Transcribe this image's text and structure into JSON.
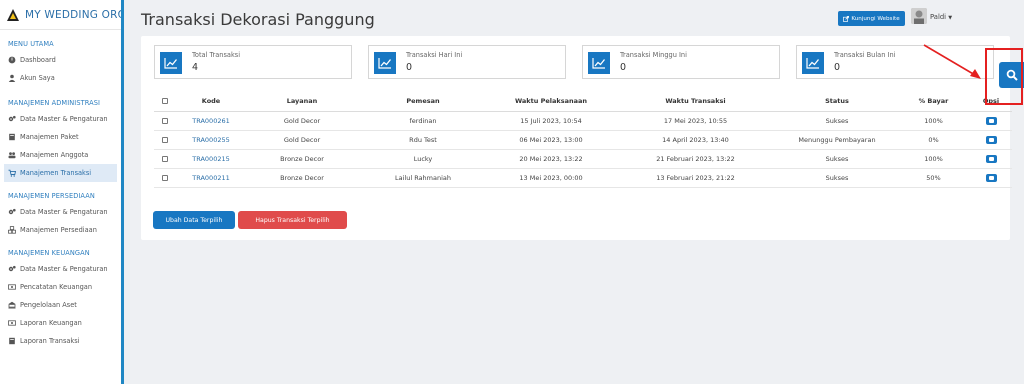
{
  "sidebar": {
    "brand": "MY WEDDING ORGAN",
    "sections": [
      {
        "title": "MENU UTAMA",
        "items": [
          {
            "label": "Dashboard",
            "icon": "dashboard-icon"
          },
          {
            "label": "Akun Saya",
            "icon": "user-icon"
          }
        ]
      },
      {
        "title": "MANAJEMEN ADMINISTRASI",
        "items": [
          {
            "label": "Data Master & Pengaturan",
            "icon": "cogs-icon"
          },
          {
            "label": "Manajemen Paket",
            "icon": "book-icon"
          },
          {
            "label": "Manajemen Anggota",
            "icon": "users-icon"
          },
          {
            "label": "Manajemen Transaksi",
            "icon": "cart-icon",
            "active": true
          }
        ]
      },
      {
        "title": "MANAJEMEN PERSEDIAAN",
        "items": [
          {
            "label": "Data Master & Pengaturan",
            "icon": "cogs-icon"
          },
          {
            "label": "Manajemen Persediaan",
            "icon": "boxes-icon"
          }
        ]
      },
      {
        "title": "MANAJEMEN KEUANGAN",
        "items": [
          {
            "label": "Data Master & Pengaturan",
            "icon": "cogs-icon"
          },
          {
            "label": "Pencatatan Keuangan",
            "icon": "money-icon"
          },
          {
            "label": "Pengelolaan Aset",
            "icon": "bank-icon"
          },
          {
            "label": "Laporan Keuangan",
            "icon": "money-icon"
          },
          {
            "label": "Laporan Transaksi",
            "icon": "book-icon"
          }
        ]
      }
    ]
  },
  "header": {
    "title": "Transaksi Dekorasi Panggung",
    "visit_button": "Kunjungi Website",
    "user_name": "Paldi"
  },
  "stats": [
    {
      "label": "Total Transaksi",
      "value": "4"
    },
    {
      "label": "Transaksi Hari Ini",
      "value": "0"
    },
    {
      "label": "Transaksi Minggu Ini",
      "value": "0"
    },
    {
      "label": "Transaksi Bulan Ini",
      "value": "0"
    }
  ],
  "table": {
    "columns": [
      "Kode",
      "Layanan",
      "Pemesan",
      "Waktu Pelaksanaan",
      "Waktu Transaksi",
      "Status",
      "% Bayar",
      "Opsi"
    ],
    "rows": [
      [
        "TRA000261",
        "Gold Decor",
        "ferdinan",
        "15 Juli 2023, 10:54",
        "17 Mei 2023, 10:55",
        "Sukses",
        "100%"
      ],
      [
        "TRA000255",
        "Gold Decor",
        "Rdu Test",
        "06 Mei 2023, 13:00",
        "14 April 2023, 13:40",
        "Menunggu Pembayaran",
        "0%"
      ],
      [
        "TRA000215",
        "Bronze Decor",
        "Lucky",
        "20 Mei 2023, 13:22",
        "21 Februari 2023, 13:22",
        "Sukses",
        "100%"
      ],
      [
        "TRA000211",
        "Bronze Decor",
        "Lailul Rahmaniah",
        "13 Mei 2023, 00:00",
        "13 Februari 2023, 21:22",
        "Sukses",
        "50%"
      ]
    ]
  },
  "actions": {
    "edit_selected": "Ubah Data Terpilih",
    "delete_selected": "Hapus Transaksi Terpilih"
  },
  "colors": {
    "accent": "#1877c2",
    "danger": "#e04b4b",
    "annotation": "#e42020"
  }
}
